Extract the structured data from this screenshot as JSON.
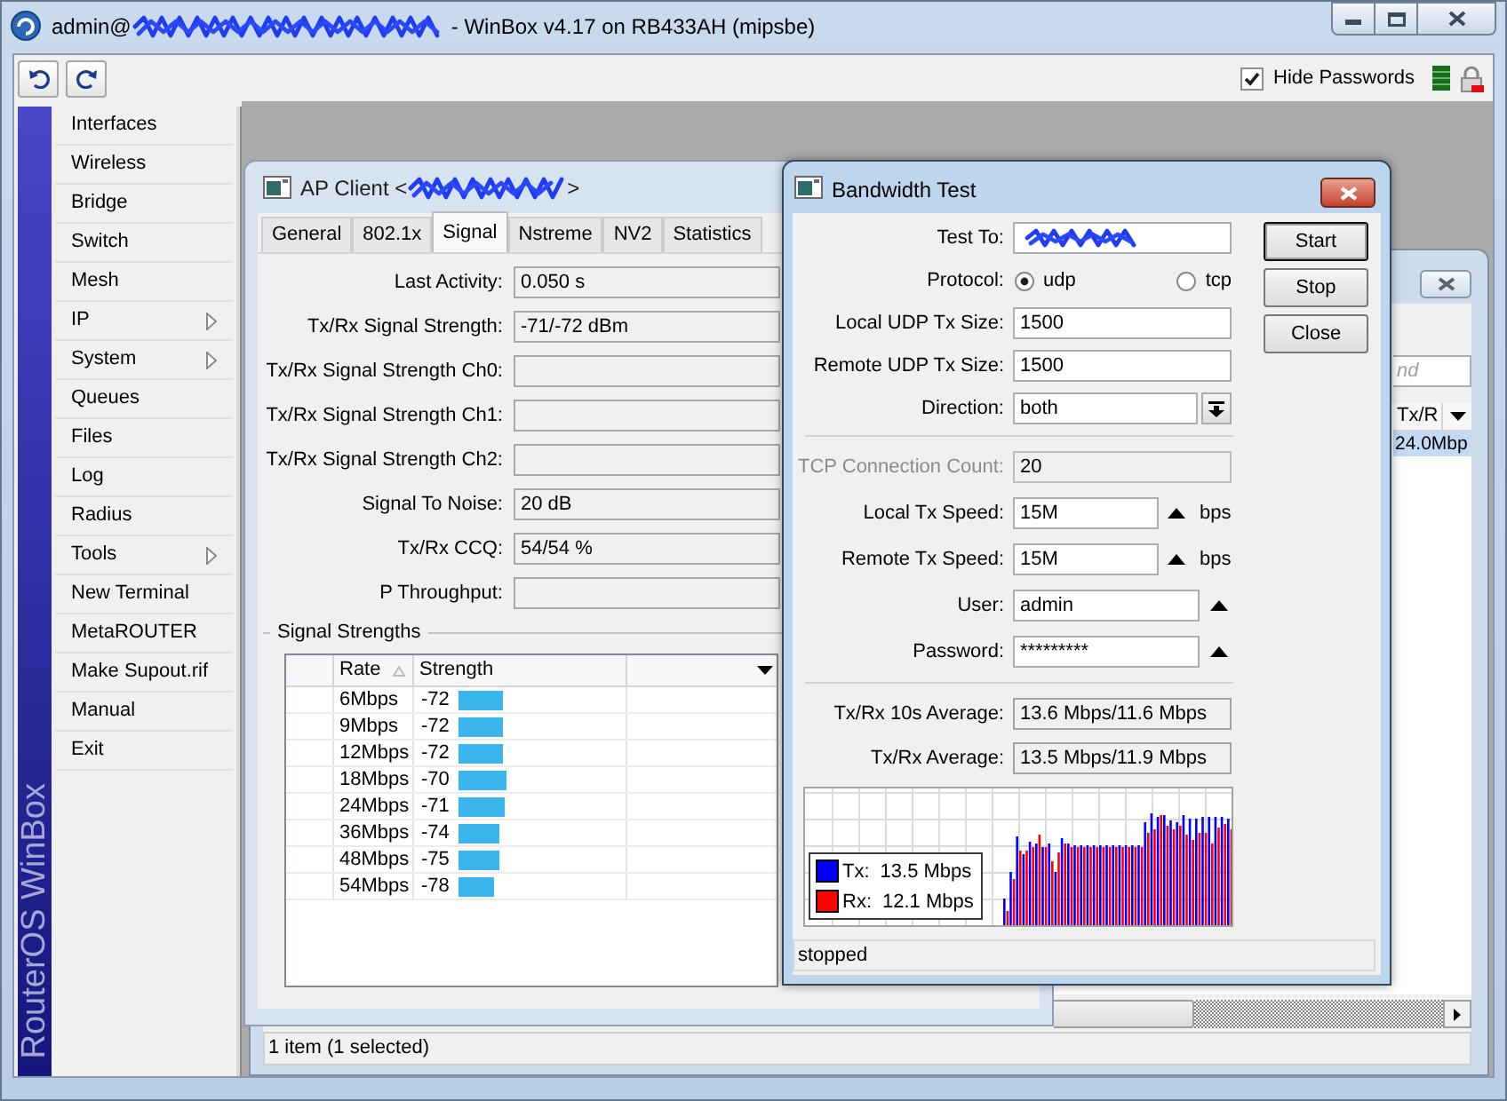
{
  "window": {
    "title_prefix": "admin@",
    "title_suffix": "- WinBox v4.17 on RB433AH (mipsbe)"
  },
  "toolbar": {
    "hide_passwords": {
      "label": "Hide Passwords",
      "checked": true
    }
  },
  "sidebar": {
    "brand": "RouterOS WinBox",
    "items": [
      {
        "label": "Interfaces",
        "submenu": false
      },
      {
        "label": "Wireless",
        "submenu": false
      },
      {
        "label": "Bridge",
        "submenu": false
      },
      {
        "label": "Switch",
        "submenu": false
      },
      {
        "label": "Mesh",
        "submenu": false
      },
      {
        "label": "IP",
        "submenu": true
      },
      {
        "label": "System",
        "submenu": true
      },
      {
        "label": "Queues",
        "submenu": false
      },
      {
        "label": "Files",
        "submenu": false
      },
      {
        "label": "Log",
        "submenu": false
      },
      {
        "label": "Radius",
        "submenu": false
      },
      {
        "label": "Tools",
        "submenu": true
      },
      {
        "label": "New Terminal",
        "submenu": false
      },
      {
        "label": "MetaROUTER",
        "submenu": false
      },
      {
        "label": "Make Supout.rif",
        "submenu": false
      },
      {
        "label": "Manual",
        "submenu": false
      },
      {
        "label": "Exit",
        "submenu": false
      }
    ]
  },
  "list_window": {
    "find": {
      "placeholder": "nd"
    },
    "columns": [
      "Tx/R"
    ],
    "rows": [
      {
        "cell": "24.0Mbp",
        "selected": true
      }
    ],
    "status_bar": "1 item (1 selected)"
  },
  "ap_client": {
    "title_prefix": "AP Client <",
    "title_suffix": ">",
    "tabs": [
      {
        "label": "General",
        "selected": false
      },
      {
        "label": "802.1x",
        "selected": false
      },
      {
        "label": "Signal",
        "selected": true
      },
      {
        "label": "Nstreme",
        "selected": false
      },
      {
        "label": "NV2",
        "selected": false
      },
      {
        "label": "Statistics",
        "selected": false
      }
    ],
    "fields": [
      {
        "label": "Last Activity:",
        "value": "0.050 s"
      },
      {
        "label": "Tx/Rx Signal Strength:",
        "value": "-71/-72 dBm"
      },
      {
        "label": "Tx/Rx Signal Strength Ch0:"
      },
      {
        "label": "Tx/Rx Signal Strength Ch1:"
      },
      {
        "label": "Tx/Rx Signal Strength Ch2:"
      },
      {
        "label": "Signal To Noise:",
        "value": "20 dB"
      },
      {
        "label": "Tx/Rx CCQ:",
        "value": "54/54 %"
      },
      {
        "label": "P Throughput:"
      }
    ],
    "signal_strengths": {
      "title": "Signal Strengths",
      "columns": [
        {
          "label": "Rate",
          "sorted": true
        },
        {
          "label": "Strength",
          "sorted": false
        }
      ],
      "rows": [
        {
          "rate": "6Mbps",
          "strength": "-72",
          "level": 0.28
        },
        {
          "rate": "9Mbps",
          "strength": "-72",
          "level": 0.28
        },
        {
          "rate": "12Mbps",
          "strength": "-72",
          "level": 0.28
        },
        {
          "rate": "18Mbps",
          "strength": "-70",
          "level": 0.3
        },
        {
          "rate": "24Mbps",
          "strength": "-71",
          "level": 0.29
        },
        {
          "rate": "36Mbps",
          "strength": "-74",
          "level": 0.26
        },
        {
          "rate": "48Mbps",
          "strength": "-75",
          "level": 0.25
        },
        {
          "rate": "54Mbps",
          "strength": "-78",
          "level": 0.22
        }
      ]
    }
  },
  "bandwidth_test": {
    "title": "Bandwidth Test",
    "sections": [
      [
        {
          "kind": "input",
          "label": "Test To:",
          "redacted": true,
          "disabled": false
        },
        {
          "kind": "radio",
          "label": "Protocol:",
          "options": [
            {
              "label": "udp",
              "selected": true
            },
            {
              "label": "tcp",
              "selected": false
            }
          ]
        },
        {
          "kind": "input",
          "label": "Local UDP Tx Size:",
          "value": "1500",
          "redacted": false,
          "disabled": false
        },
        {
          "kind": "input",
          "label": "Remote UDP Tx Size:",
          "value": "1500",
          "redacted": false,
          "disabled": false
        },
        {
          "kind": "select",
          "label": "Direction:",
          "value": "both"
        }
      ],
      [
        {
          "kind": "input",
          "label": "TCP Connection Count:",
          "value": "20",
          "redacted": false,
          "disabled": true
        },
        {
          "kind": "toggle",
          "label": "Local Tx Speed:",
          "value": "15M",
          "unit": "bps"
        },
        {
          "kind": "toggle",
          "label": "Remote Tx Speed:",
          "value": "15M",
          "unit": "bps"
        },
        {
          "kind": "toggle",
          "label": "User:",
          "value": "admin"
        },
        {
          "kind": "toggle",
          "label": "Password:",
          "value": "*********"
        }
      ],
      [
        {
          "kind": "readonly",
          "label": "Tx/Rx 10s Average:",
          "value": "13.6 Mbps/11.6 Mbps"
        },
        {
          "kind": "readonly",
          "label": "Tx/Rx Average:",
          "value": "13.5 Mbps/11.9 Mbps"
        }
      ]
    ],
    "legend": [
      {
        "label": "Tx:",
        "value": "13.5 Mbps",
        "color": "#0000ff"
      },
      {
        "label": "Rx:",
        "value": "12.1 Mbps",
        "color": "#ff0000"
      }
    ],
    "status": "stopped",
    "buttons": [
      {
        "label": "Start",
        "default": true
      },
      {
        "label": "Stop",
        "default": false
      },
      {
        "label": "Close",
        "default": false
      }
    ]
  }
}
